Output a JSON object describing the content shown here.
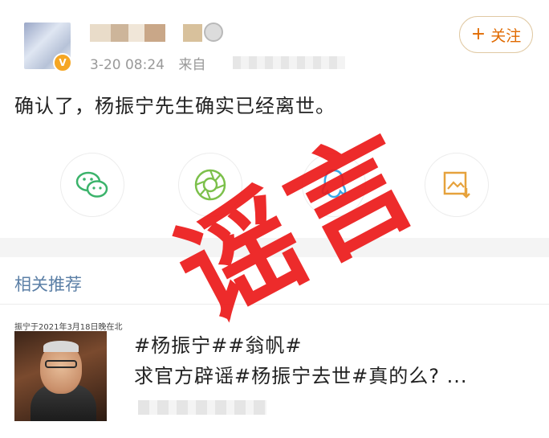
{
  "post": {
    "author_badge": "V",
    "time": "3-20 08:24",
    "source_prefix": "来自",
    "follow_label": "关注",
    "follow_plus": "+",
    "text": "确认了，杨振宁先生确实已经离世。"
  },
  "share": [
    {
      "icon": "wechat-icon",
      "color": "#3bb36b"
    },
    {
      "icon": "moments-icon",
      "color": "#7cc04b"
    },
    {
      "icon": "qq-icon",
      "color": "#3aa7e6"
    },
    {
      "icon": "save-image-icon",
      "color": "#e6a23c"
    }
  ],
  "related": {
    "title": "相关推荐",
    "item": {
      "thumb_caption": "振宁于2021年3月18日晚在北",
      "line1": "#杨振宁##翁帆#",
      "line2": "求官方辟谣#杨振宁去世#真的么? ..."
    }
  },
  "stamp": {
    "text": "谣言",
    "color": "#eb1919"
  }
}
